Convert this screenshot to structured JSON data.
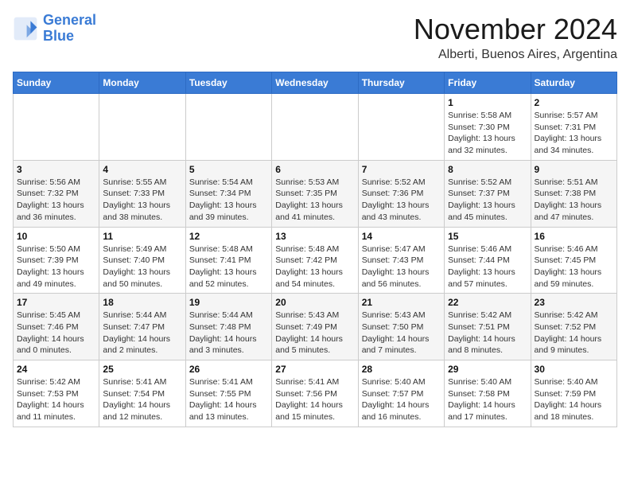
{
  "logo": {
    "line1": "General",
    "line2": "Blue"
  },
  "title": "November 2024",
  "location": "Alberti, Buenos Aires, Argentina",
  "weekdays": [
    "Sunday",
    "Monday",
    "Tuesday",
    "Wednesday",
    "Thursday",
    "Friday",
    "Saturday"
  ],
  "weeks": [
    [
      null,
      null,
      null,
      null,
      null,
      {
        "day": "1",
        "sunrise": "Sunrise: 5:58 AM",
        "sunset": "Sunset: 7:30 PM",
        "daylight": "Daylight: 13 hours and 32 minutes."
      },
      {
        "day": "2",
        "sunrise": "Sunrise: 5:57 AM",
        "sunset": "Sunset: 7:31 PM",
        "daylight": "Daylight: 13 hours and 34 minutes."
      }
    ],
    [
      {
        "day": "3",
        "sunrise": "Sunrise: 5:56 AM",
        "sunset": "Sunset: 7:32 PM",
        "daylight": "Daylight: 13 hours and 36 minutes."
      },
      {
        "day": "4",
        "sunrise": "Sunrise: 5:55 AM",
        "sunset": "Sunset: 7:33 PM",
        "daylight": "Daylight: 13 hours and 38 minutes."
      },
      {
        "day": "5",
        "sunrise": "Sunrise: 5:54 AM",
        "sunset": "Sunset: 7:34 PM",
        "daylight": "Daylight: 13 hours and 39 minutes."
      },
      {
        "day": "6",
        "sunrise": "Sunrise: 5:53 AM",
        "sunset": "Sunset: 7:35 PM",
        "daylight": "Daylight: 13 hours and 41 minutes."
      },
      {
        "day": "7",
        "sunrise": "Sunrise: 5:52 AM",
        "sunset": "Sunset: 7:36 PM",
        "daylight": "Daylight: 13 hours and 43 minutes."
      },
      {
        "day": "8",
        "sunrise": "Sunrise: 5:52 AM",
        "sunset": "Sunset: 7:37 PM",
        "daylight": "Daylight: 13 hours and 45 minutes."
      },
      {
        "day": "9",
        "sunrise": "Sunrise: 5:51 AM",
        "sunset": "Sunset: 7:38 PM",
        "daylight": "Daylight: 13 hours and 47 minutes."
      }
    ],
    [
      {
        "day": "10",
        "sunrise": "Sunrise: 5:50 AM",
        "sunset": "Sunset: 7:39 PM",
        "daylight": "Daylight: 13 hours and 49 minutes."
      },
      {
        "day": "11",
        "sunrise": "Sunrise: 5:49 AM",
        "sunset": "Sunset: 7:40 PM",
        "daylight": "Daylight: 13 hours and 50 minutes."
      },
      {
        "day": "12",
        "sunrise": "Sunrise: 5:48 AM",
        "sunset": "Sunset: 7:41 PM",
        "daylight": "Daylight: 13 hours and 52 minutes."
      },
      {
        "day": "13",
        "sunrise": "Sunrise: 5:48 AM",
        "sunset": "Sunset: 7:42 PM",
        "daylight": "Daylight: 13 hours and 54 minutes."
      },
      {
        "day": "14",
        "sunrise": "Sunrise: 5:47 AM",
        "sunset": "Sunset: 7:43 PM",
        "daylight": "Daylight: 13 hours and 56 minutes."
      },
      {
        "day": "15",
        "sunrise": "Sunrise: 5:46 AM",
        "sunset": "Sunset: 7:44 PM",
        "daylight": "Daylight: 13 hours and 57 minutes."
      },
      {
        "day": "16",
        "sunrise": "Sunrise: 5:46 AM",
        "sunset": "Sunset: 7:45 PM",
        "daylight": "Daylight: 13 hours and 59 minutes."
      }
    ],
    [
      {
        "day": "17",
        "sunrise": "Sunrise: 5:45 AM",
        "sunset": "Sunset: 7:46 PM",
        "daylight": "Daylight: 14 hours and 0 minutes."
      },
      {
        "day": "18",
        "sunrise": "Sunrise: 5:44 AM",
        "sunset": "Sunset: 7:47 PM",
        "daylight": "Daylight: 14 hours and 2 minutes."
      },
      {
        "day": "19",
        "sunrise": "Sunrise: 5:44 AM",
        "sunset": "Sunset: 7:48 PM",
        "daylight": "Daylight: 14 hours and 3 minutes."
      },
      {
        "day": "20",
        "sunrise": "Sunrise: 5:43 AM",
        "sunset": "Sunset: 7:49 PM",
        "daylight": "Daylight: 14 hours and 5 minutes."
      },
      {
        "day": "21",
        "sunrise": "Sunrise: 5:43 AM",
        "sunset": "Sunset: 7:50 PM",
        "daylight": "Daylight: 14 hours and 7 minutes."
      },
      {
        "day": "22",
        "sunrise": "Sunrise: 5:42 AM",
        "sunset": "Sunset: 7:51 PM",
        "daylight": "Daylight: 14 hours and 8 minutes."
      },
      {
        "day": "23",
        "sunrise": "Sunrise: 5:42 AM",
        "sunset": "Sunset: 7:52 PM",
        "daylight": "Daylight: 14 hours and 9 minutes."
      }
    ],
    [
      {
        "day": "24",
        "sunrise": "Sunrise: 5:42 AM",
        "sunset": "Sunset: 7:53 PM",
        "daylight": "Daylight: 14 hours and 11 minutes."
      },
      {
        "day": "25",
        "sunrise": "Sunrise: 5:41 AM",
        "sunset": "Sunset: 7:54 PM",
        "daylight": "Daylight: 14 hours and 12 minutes."
      },
      {
        "day": "26",
        "sunrise": "Sunrise: 5:41 AM",
        "sunset": "Sunset: 7:55 PM",
        "daylight": "Daylight: 14 hours and 13 minutes."
      },
      {
        "day": "27",
        "sunrise": "Sunrise: 5:41 AM",
        "sunset": "Sunset: 7:56 PM",
        "daylight": "Daylight: 14 hours and 15 minutes."
      },
      {
        "day": "28",
        "sunrise": "Sunrise: 5:40 AM",
        "sunset": "Sunset: 7:57 PM",
        "daylight": "Daylight: 14 hours and 16 minutes."
      },
      {
        "day": "29",
        "sunrise": "Sunrise: 5:40 AM",
        "sunset": "Sunset: 7:58 PM",
        "daylight": "Daylight: 14 hours and 17 minutes."
      },
      {
        "day": "30",
        "sunrise": "Sunrise: 5:40 AM",
        "sunset": "Sunset: 7:59 PM",
        "daylight": "Daylight: 14 hours and 18 minutes."
      }
    ]
  ]
}
